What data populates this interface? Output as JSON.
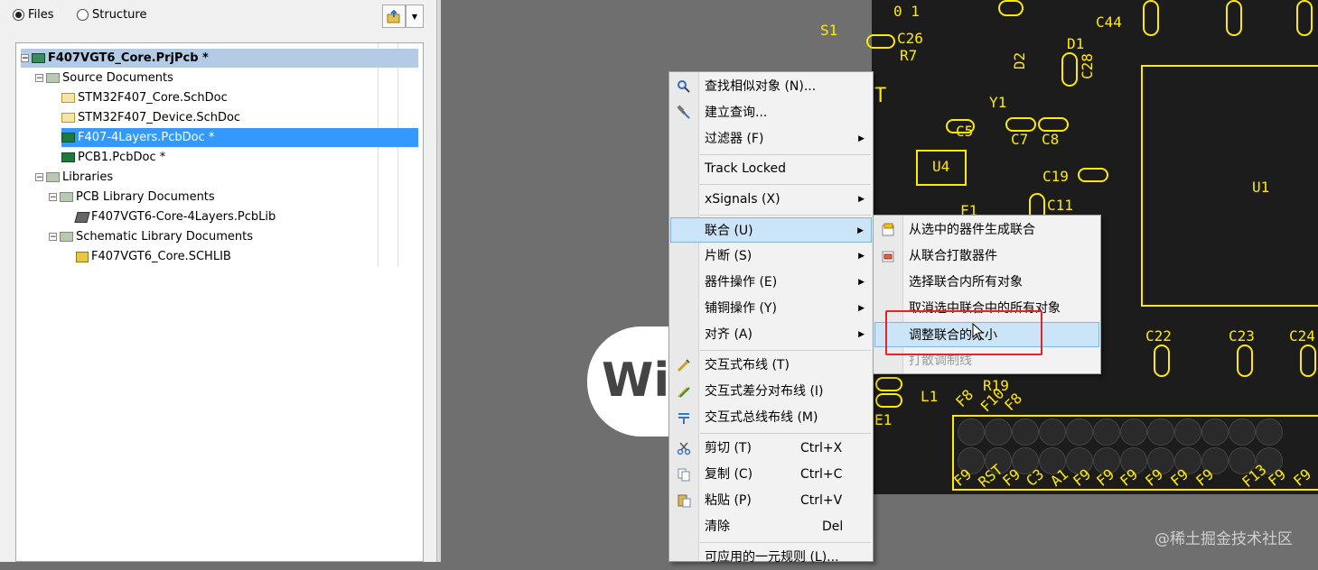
{
  "panel": {
    "radio_files": "Files",
    "radio_structure": "Structure"
  },
  "tree": {
    "root": "F407VGT6_Core.PrjPcb *",
    "source_documents": "Source Documents",
    "sch1": "STM32F407_Core.SchDoc",
    "sch2": "STM32F407_Device.SchDoc",
    "pcb1": "F407-4Layers.PcbDoc *",
    "pcb2": "PCB1.PcbDoc *",
    "libraries": "Libraries",
    "pcb_lib_docs": "PCB Library Documents",
    "pcblib": "F407VGT6-Core-4Layers.PcbLib",
    "sch_lib_docs": "Schematic Library Documents",
    "schlib": "F407VGT6_Core.SCHLIB"
  },
  "menu": {
    "find_similar": "查找相似对象 (N)...",
    "build_query": "建立查询...",
    "filter": "过滤器 (F)",
    "track_locked": "Track Locked",
    "xsignals": "xSignals (X)",
    "union": "联合 (U)",
    "fragments": "片断 (S)",
    "component_ops": "器件操作 (E)",
    "copper_ops": "铺铜操作 (Y)",
    "align": "对齐 (A)",
    "interactive_route": "交互式布线 (T)",
    "diff_pair_route": "交互式差分对布线 (I)",
    "bus_route": "交互式总线布线 (M)",
    "cut": "剪切 (T)",
    "cut_sc": "Ctrl+X",
    "copy": "复制 (C)",
    "copy_sc": "Ctrl+C",
    "paste": "粘贴 (P)",
    "paste_sc": "Ctrl+V",
    "clear": "清除",
    "clear_sc": "Del",
    "rules": "可应用的一元规则 (L)..."
  },
  "submenu": {
    "create_union": "从选中的器件生成联合",
    "break_union": "从联合打散器件",
    "select_all_in_union": "选择联合内所有对象",
    "deselect_all_in_union": "取消选中联合中的所有对象",
    "resize_union": "调整联合的大小",
    "break_tuning": "打散调制线"
  },
  "board_labels": [
    "0 1",
    "S1",
    "C26",
    "R7",
    "D1",
    "C44",
    "D2",
    "C28",
    "T",
    "Y1",
    "C5",
    "C7",
    "C8",
    "U4",
    "C19",
    "U1",
    "F1",
    "C11",
    "C22",
    "C23",
    "C24",
    "R19",
    "F8",
    "F10",
    "F8",
    "L1",
    "E1",
    "F9",
    "RST",
    "F9",
    "C3",
    "A1",
    "F9",
    "F9",
    "F9",
    "F9",
    "F9",
    "F9",
    "F13",
    "F9",
    "F9"
  ],
  "watermark": {
    "bubble": "Wi",
    "corner": "@稀土掘金技术社区"
  }
}
